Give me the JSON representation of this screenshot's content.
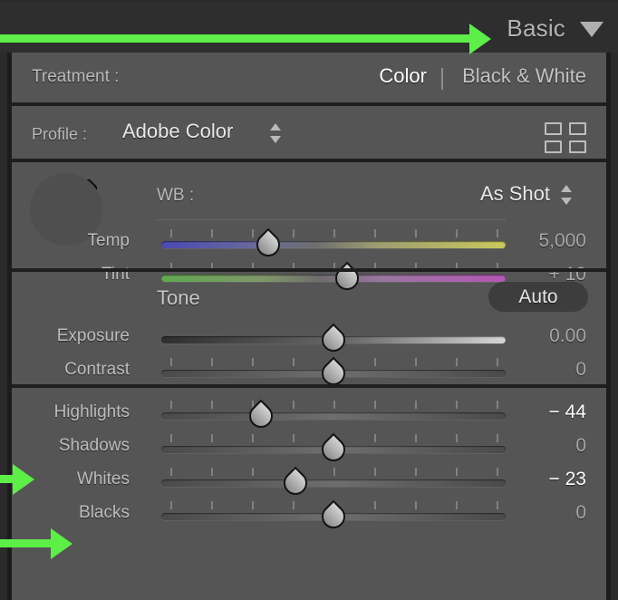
{
  "header": {
    "title": "Basic",
    "disclosure_icon": "triangle-down-icon"
  },
  "treatment": {
    "label": "Treatment :",
    "color_label": "Color",
    "bw_label": "Black & White",
    "selected": "Color"
  },
  "profile": {
    "label": "Profile :",
    "value": "Adobe Color",
    "stepper_icon": "stepper-updown-icon",
    "browse_icon": "profile-grid-icon"
  },
  "wb": {
    "eyedropper_icon": "eyedropper-icon",
    "label": "WB :",
    "value": "As Shot",
    "stepper_icon": "stepper-updown-icon",
    "sliders": [
      {
        "name": "Temp",
        "value": "5,000",
        "pos": 31,
        "modified": false,
        "ticks": 9,
        "grad": "grad-temp"
      },
      {
        "name": "Tint",
        "value": "+ 10",
        "pos": 54,
        "modified": false,
        "ticks": 9,
        "grad": "grad-tint"
      }
    ]
  },
  "tone": {
    "title": "Tone",
    "auto_label": "Auto",
    "sliders": [
      {
        "name": "Exposure",
        "value": "0.00",
        "pos": 50,
        "modified": false,
        "ticks": 0,
        "grad": "grad-exp"
      },
      {
        "name": "Contrast",
        "value": "0",
        "pos": 50,
        "modified": false,
        "ticks": 9,
        "grad": "lite"
      }
    ]
  },
  "bottom": {
    "sliders": [
      {
        "name": "Highlights",
        "value": "− 44",
        "pos": 29,
        "modified": true,
        "ticks": 9,
        "grad": "lite"
      },
      {
        "name": "Shadows",
        "value": "0",
        "pos": 50,
        "modified": false,
        "ticks": 9,
        "grad": "lite"
      },
      {
        "name": "Whites",
        "value": "− 23",
        "pos": 39,
        "modified": true,
        "ticks": 9,
        "grad": "lite"
      },
      {
        "name": "Blacks",
        "value": "0",
        "pos": 50,
        "modified": false,
        "ticks": 9,
        "grad": "lite"
      }
    ]
  },
  "annotations": {
    "arrow_color": "#5dee48",
    "targets": [
      "Basic",
      "Highlights",
      "Whites"
    ]
  }
}
